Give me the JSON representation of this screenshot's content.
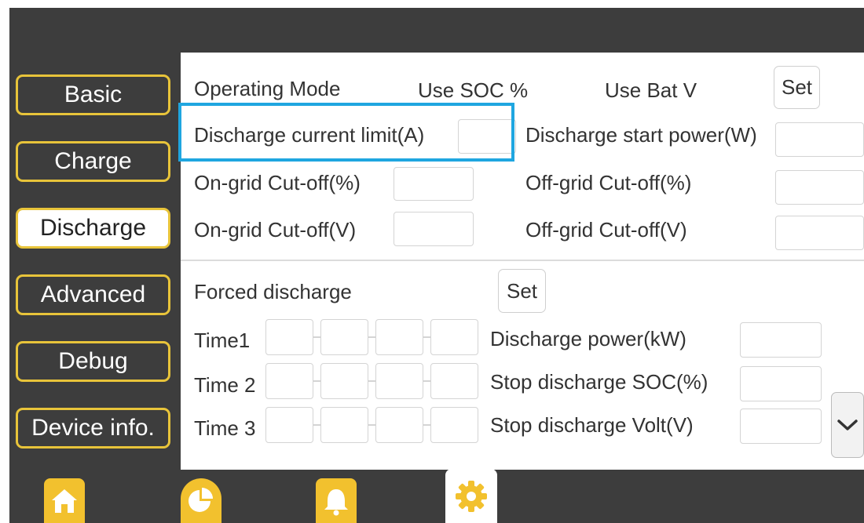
{
  "sidebar": {
    "items": [
      {
        "label": "Basic",
        "active": false
      },
      {
        "label": "Charge",
        "active": false
      },
      {
        "label": "Discharge",
        "active": true
      },
      {
        "label": "Advanced",
        "active": false
      },
      {
        "label": "Debug",
        "active": false
      },
      {
        "label": "Device info.",
        "active": false
      }
    ]
  },
  "discharge_settings": {
    "operating_mode_label": "Operating Mode",
    "use_soc_label": "Use SOC %",
    "use_bat_v_label": "Use Bat V",
    "set_label": "Set",
    "discharge_current_limit_label": "Discharge current limit(A)",
    "discharge_start_power_label": "Discharge start power(W)",
    "on_grid_cutoff_pct_label": "On-grid Cut-off(%)",
    "off_grid_cutoff_pct_label": "Off-grid Cut-off(%)",
    "on_grid_cutoff_v_label": "On-grid Cut-off(V)",
    "off_grid_cutoff_v_label": "Off-grid Cut-off(V)"
  },
  "forced_discharge": {
    "title": "Forced discharge",
    "set_label": "Set",
    "time_labels": [
      "Time1",
      "Time 2",
      "Time 3"
    ],
    "discharge_power_label": "Discharge power(kW)",
    "stop_soc_label": "Stop discharge SOC(%)",
    "stop_volt_label": "Stop discharge Volt(V)"
  },
  "bottom_nav": {
    "icons": [
      "home-icon",
      "pie-chart-icon",
      "bell-icon",
      "gear-icon"
    ],
    "active": "gear-icon"
  },
  "colors": {
    "background": "#3d3d3d",
    "accent": "#e8c43a",
    "icon_yellow": "#f2c12e",
    "highlight": "#1fa6e0"
  }
}
